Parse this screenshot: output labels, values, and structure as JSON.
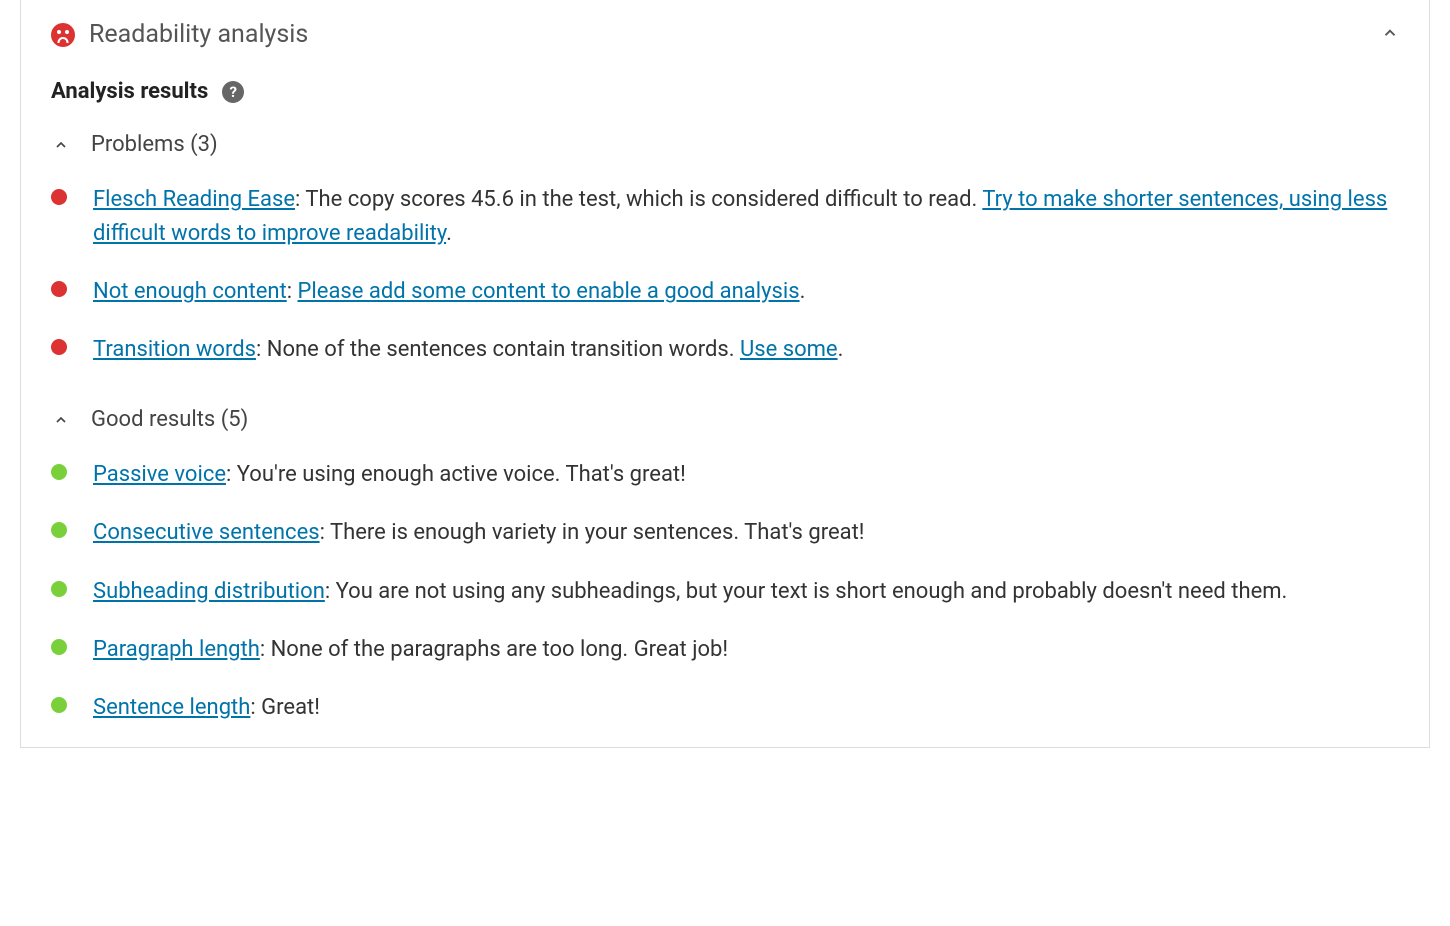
{
  "panel": {
    "title": "Readability analysis",
    "subtitle": "Analysis results",
    "help_glyph": "?"
  },
  "sections": {
    "problems": {
      "label": "Problems (3)",
      "items": [
        {
          "link1": "Flesch Reading Ease",
          "mid": ": The copy scores 45.6 in the test, which is considered difficult to read. ",
          "link2": "Try to make shorter sentences, using less difficult words to improve readability",
          "tail": "."
        },
        {
          "link1": "Not enough content",
          "mid": ": ",
          "link2": "Please add some content to enable a good analysis",
          "tail": "."
        },
        {
          "link1": "Transition words",
          "mid": ": None of the sentences contain transition words. ",
          "link2": "Use some",
          "tail": "."
        }
      ]
    },
    "good": {
      "label": "Good results (5)",
      "items": [
        {
          "link1": "Passive voice",
          "mid": ": You're using enough active voice. That's great!",
          "link2": "",
          "tail": ""
        },
        {
          "link1": "Consecutive sentences",
          "mid": ": There is enough variety in your sentences. That's great!",
          "link2": "",
          "tail": ""
        },
        {
          "link1": "Subheading distribution",
          "mid": ": You are not using any subheadings, but your text is short enough and probably doesn't need them.",
          "link2": "",
          "tail": ""
        },
        {
          "link1": "Paragraph length",
          "mid": ": None of the paragraphs are too long. Great job!",
          "link2": "",
          "tail": ""
        },
        {
          "link1": "Sentence length",
          "mid": ": Great!",
          "link2": "",
          "tail": ""
        }
      ]
    }
  }
}
